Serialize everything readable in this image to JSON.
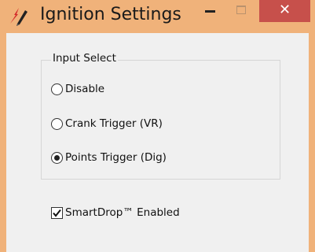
{
  "window": {
    "title": "Ignition Settings",
    "icon": "lightning-pen-icon",
    "controls": {
      "minimize": "minimize-icon",
      "maximize": "maximize-icon",
      "close_label": "✕"
    },
    "accent_color": "#f0b27a",
    "close_color": "#c7504b"
  },
  "input_select": {
    "title": "Input Select",
    "options": [
      {
        "label": "Disable",
        "checked": false
      },
      {
        "label": "Crank Trigger (VR)",
        "checked": false
      },
      {
        "label": "Points Trigger (Dig)",
        "checked": true
      }
    ]
  },
  "smartdrop": {
    "label": "SmartDrop™ Enabled",
    "checked": true
  }
}
